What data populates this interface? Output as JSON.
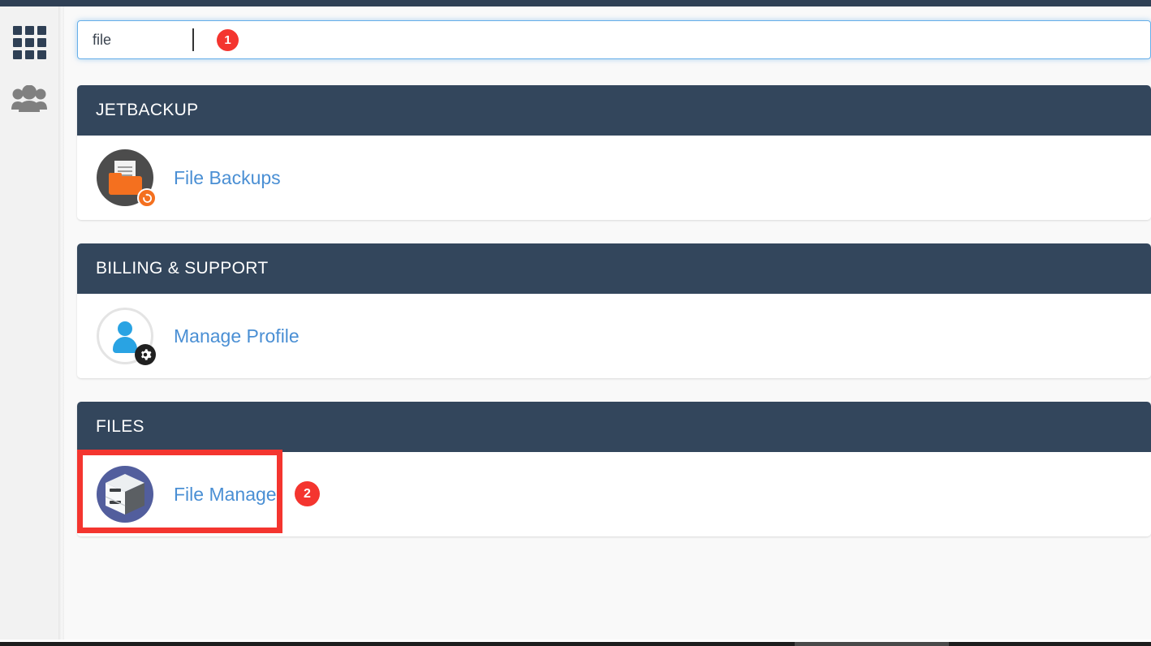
{
  "window": {
    "topbar_color": "#2f4055",
    "background_color": "#f9f9f9"
  },
  "sidebar": {
    "items": [
      {
        "name": "apps-grid",
        "icon": "grid-icon",
        "label": ""
      },
      {
        "name": "user-manager",
        "icon": "users-icon",
        "label": ""
      }
    ]
  },
  "search": {
    "value": "file",
    "placeholder": "",
    "accent_color": "#66afe9"
  },
  "annotations": [
    {
      "number": "1",
      "target": "search-input",
      "color": "#f4352f"
    },
    {
      "number": "2",
      "target": "file-manager-link",
      "color": "#f4352f"
    }
  ],
  "sections": [
    {
      "id": "jetbackup",
      "title": "JETBACKUP",
      "items": [
        {
          "label": "File Backups",
          "icon": "file-backups-icon"
        }
      ]
    },
    {
      "id": "billing",
      "title": "BILLING & SUPPORT",
      "items": [
        {
          "label": "Manage Profile",
          "icon": "manage-profile-icon"
        }
      ]
    },
    {
      "id": "files",
      "title": "FILES",
      "items": [
        {
          "label": "File Manager",
          "icon": "file-manager-icon"
        }
      ]
    }
  ],
  "colors": {
    "header_bg": "#33465c",
    "link": "#4a8fd4",
    "badge": "#f4352f",
    "orange": "#f4701f",
    "profile_blue": "#29a3e3",
    "filemanager_purple": "#525e9d"
  }
}
